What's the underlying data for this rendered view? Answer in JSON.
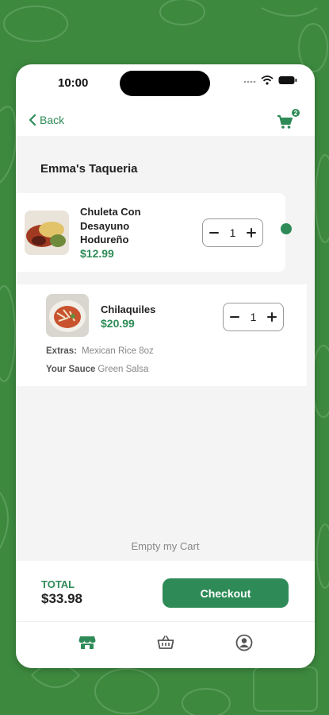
{
  "status_bar": {
    "time": "10:00"
  },
  "nav": {
    "back_label": "Back",
    "cart_count": "2"
  },
  "restaurant": {
    "name": "Emma's Taqueria"
  },
  "items": [
    {
      "name_line1": "Chuleta Con",
      "name_line2": "Desayuno",
      "name_line3": "Hodureño",
      "price": "$12.99",
      "quantity": "1"
    },
    {
      "name": "Chilaquiles",
      "price": "$20.99",
      "quantity": "1",
      "extras": [
        {
          "label": "Extras:",
          "value": "Mexican Rice 8oz"
        },
        {
          "label": "Your Sauce",
          "value": "Green Salsa"
        }
      ]
    }
  ],
  "empty_cart_label": "Empty my Cart",
  "total": {
    "label": "TOTAL",
    "value": "$33.98"
  },
  "checkout_label": "Checkout",
  "tabs": [
    "store-icon",
    "basket-icon",
    "account-icon"
  ],
  "colors": {
    "brand_green": "#2e8b57",
    "background_green": "#3d8a3f"
  }
}
